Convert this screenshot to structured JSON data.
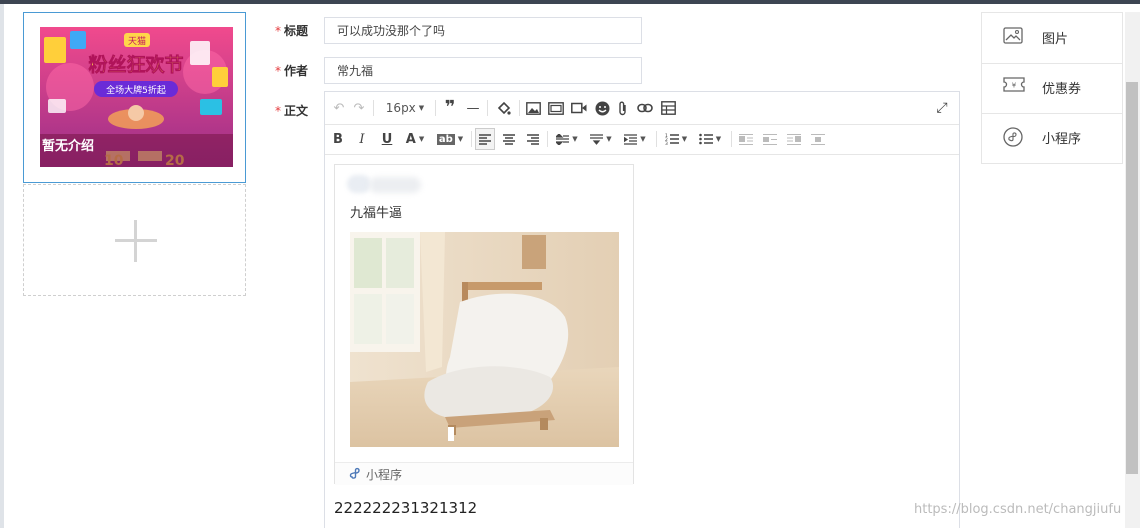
{
  "cover": {
    "caption": "暂无介绍",
    "banner_main_text": "粉丝狂欢节",
    "banner_badge": "天猫",
    "banner_sub_text": "全场大牌5折起",
    "coupon_left": "10",
    "coupon_right": "20",
    "colors": {
      "bg_top": "#e83f86",
      "bg_bottom": "#8c2e86",
      "accent": "#ffd64a"
    }
  },
  "form": {
    "required_mark": "*",
    "title_label": "标题",
    "title_value": "可以成功没那个了吗",
    "author_label": "作者",
    "author_value": "常九福",
    "content_label": "正文"
  },
  "editor": {
    "font_size": "16px",
    "toolbar_row1": [
      "undo-icon",
      "redo-icon",
      "font-size",
      "quote-icon",
      "horizontal-rule-icon",
      "paint-icon",
      "image-icon",
      "image-gallery-icon",
      "video-icon",
      "emoji-icon",
      "attachment-icon",
      "link-icon",
      "table-icon",
      "fullscreen-icon"
    ],
    "toolbar_row2": [
      "bold",
      "italic",
      "underline",
      "font-color",
      "background-color",
      "align-left",
      "align-center",
      "align-right",
      "line-height",
      "paragraph-spacing",
      "indent",
      "ordered-list",
      "unordered-list",
      "float-left",
      "float-none",
      "float-right",
      "float-center"
    ],
    "labels": {
      "bold": "B",
      "italic": "I",
      "underline": "U",
      "font_color": "A",
      "background_color": "ab"
    },
    "mini_program_card": {
      "title": "九福牛逼",
      "footer": "小程序"
    },
    "body_text": "222222231321312"
  },
  "right_panel": {
    "items": [
      {
        "label": "图片",
        "icon": "image-icon"
      },
      {
        "label": "优惠券",
        "icon": "coupon-icon"
      },
      {
        "label": "小程序",
        "icon": "mini-program-icon"
      }
    ]
  },
  "watermark": "https://blog.csdn.net/changjiufu"
}
